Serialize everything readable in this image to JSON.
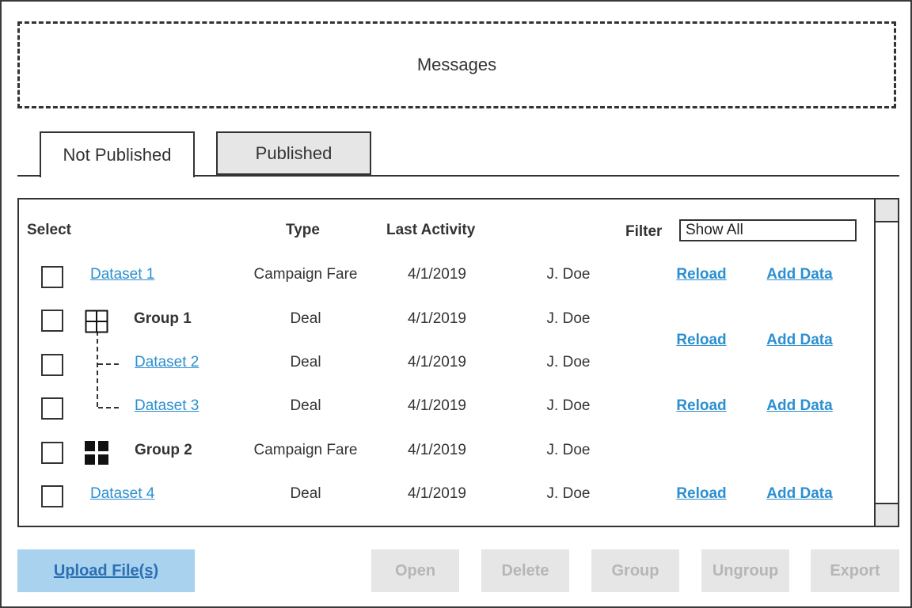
{
  "messages": {
    "label": "Messages"
  },
  "tabs": [
    {
      "label": "Not Published",
      "active": true
    },
    {
      "label": "Published",
      "active": false
    }
  ],
  "table": {
    "headers": {
      "select": "Select",
      "type": "Type",
      "last_activity": "Last Activity",
      "filter": "Filter"
    },
    "filter_value": "Show All",
    "rows": [
      {
        "name": "Dataset 1",
        "kind": "dataset",
        "type": "Campaign Fare",
        "date": "4/1/2019",
        "user": "J. Doe"
      },
      {
        "name": "Group 1",
        "kind": "group",
        "expanded": true,
        "type": "Deal",
        "date": "4/1/2019",
        "user": "J. Doe"
      },
      {
        "name": "Dataset 2",
        "kind": "dataset-child",
        "type": "Deal",
        "date": "4/1/2019",
        "user": "J. Doe"
      },
      {
        "name": "Dataset 3",
        "kind": "dataset-child",
        "type": "Deal",
        "date": "4/1/2019",
        "user": "J. Doe"
      },
      {
        "name": "Group 2",
        "kind": "group",
        "expanded": false,
        "type": "Campaign Fare",
        "date": "4/1/2019",
        "user": "J. Doe"
      },
      {
        "name": "Dataset 4",
        "kind": "dataset",
        "type": "Deal",
        "date": "4/1/2019",
        "user": "J. Doe"
      }
    ],
    "actions": {
      "reload": "Reload",
      "add_data": "Add Data"
    }
  },
  "footer": {
    "upload": "Upload File(s)",
    "open": "Open",
    "delete": "Delete",
    "group": "Group",
    "ungroup": "Ungroup",
    "export": "Export"
  },
  "icons": {
    "expand": "grid-expanded-icon",
    "collapse": "grid-collapsed-icon"
  },
  "colors": {
    "link": "#2b8fd0",
    "upload_bg": "#a9d2ef",
    "disabled_bg": "#e6e6e6"
  }
}
